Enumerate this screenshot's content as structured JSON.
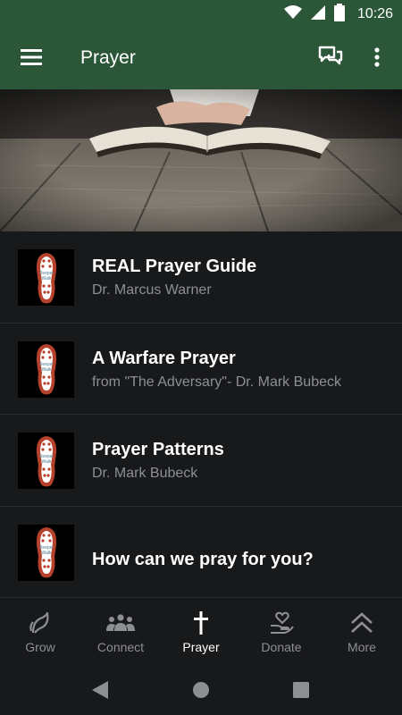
{
  "status": {
    "time": "10:26",
    "icons": [
      "wifi-icon",
      "signal-icon",
      "battery-icon"
    ]
  },
  "app_bar": {
    "title": "Prayer",
    "icons": [
      "hamburger-menu-icon",
      "chat-icon",
      "more-vert-icon"
    ]
  },
  "colors": {
    "app_bar": "#2b5637",
    "background": "#18191b",
    "subtitle": "#8d8f92",
    "thumb_shoe": "#b5412c"
  },
  "items": [
    {
      "title": "REAL Prayer Guide",
      "subtitle": "Dr. Marcus Warner"
    },
    {
      "title": "A Warfare Prayer",
      "subtitle": "from \"The Adversary\"- Dr. Mark Bubeck"
    },
    {
      "title": "Prayer Patterns",
      "subtitle": "Dr. Mark Bubeck"
    },
    {
      "title": "How can we pray for you?",
      "subtitle": ""
    }
  ],
  "thumb_label": [
    "Deeper",
    "Walk"
  ],
  "bottom_nav": [
    {
      "label": "Grow",
      "icon": "sprout-icon",
      "active": false
    },
    {
      "label": "Connect",
      "icon": "group-icon",
      "active": false
    },
    {
      "label": "Prayer",
      "icon": "cross-icon",
      "active": true
    },
    {
      "label": "Donate",
      "icon": "heart-hand-icon",
      "active": false
    },
    {
      "label": "More",
      "icon": "double-chevron-up-icon",
      "active": false
    }
  ],
  "system_nav": [
    "back-icon",
    "home-icon",
    "recents-icon"
  ]
}
